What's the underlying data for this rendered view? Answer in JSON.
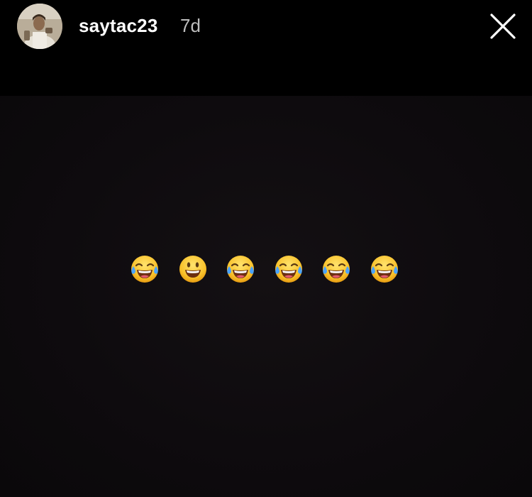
{
  "header": {
    "username": "saytac23",
    "time_ago": "7d",
    "avatar_icon": "user-avatar-photo",
    "close_icon": "close-x-icon"
  },
  "story": {
    "background_color": "#0e0b0e",
    "emojis": [
      {
        "name": "face-with-tears-of-joy",
        "glyph": "😂"
      },
      {
        "name": "grinning-face",
        "glyph": "😀"
      },
      {
        "name": "face-with-tears-of-joy",
        "glyph": "😂"
      },
      {
        "name": "face-with-tears-of-joy",
        "glyph": "😂"
      },
      {
        "name": "face-with-tears-of-joy",
        "glyph": "😂"
      },
      {
        "name": "face-with-tears-of-joy",
        "glyph": "😂"
      }
    ]
  }
}
